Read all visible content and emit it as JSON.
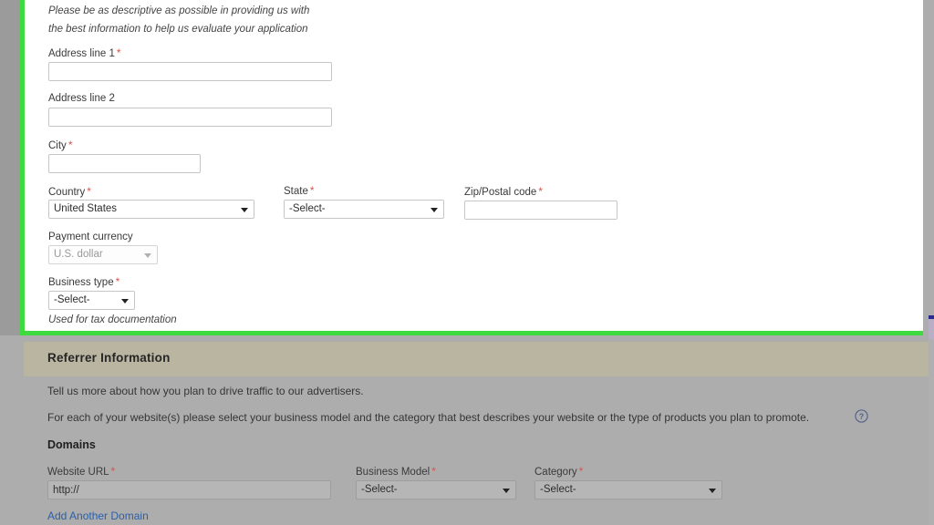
{
  "colors": {
    "highlight_border": "#3ddb3d",
    "section_header_bg": "#b9b5a0",
    "page_bg": "#adadad",
    "required_marker": "#d9534f",
    "link": "#2b5fa8"
  },
  "form": {
    "description_hint_line1": "Please be as descriptive as possible in providing us with",
    "description_hint_line2": "the best information to help us evaluate your application",
    "fields": {
      "address_line_1": {
        "label": "Address line 1",
        "required_marker": "*",
        "value": "",
        "placeholder": ""
      },
      "address_line_2": {
        "label": "Address line 2",
        "required_marker": "",
        "value": "",
        "placeholder": ""
      },
      "city": {
        "label": "City",
        "required_marker": "*",
        "value": "",
        "placeholder": ""
      },
      "country": {
        "label": "Country",
        "required_marker": "*",
        "value": "United States"
      },
      "state": {
        "label": "State",
        "required_marker": "*",
        "value": "-Select-"
      },
      "zip_postal": {
        "label": "Zip/Postal code",
        "required_marker": "*",
        "value": "",
        "placeholder": ""
      },
      "payment_currency": {
        "label": "Payment currency",
        "required_marker": "",
        "value": "U.S. dollar",
        "disabled": true
      },
      "business_type": {
        "label": "Business type",
        "required_marker": "*",
        "value": "-Select-"
      }
    },
    "business_type_hint": "Used for tax documentation"
  },
  "referrer": {
    "header_title": "Referrer Information",
    "paragraph_1": "Tell us more about how you plan to drive traffic to our advertisers.",
    "paragraph_2": "For each of your website(s) please select your business model and the category that best describes your website or the type of products you plan to promote.",
    "help_icon_glyph": "?",
    "domains_title": "Domains",
    "domain_fields": {
      "website_url": {
        "label": "Website URL",
        "required_marker": "*",
        "value": "http://"
      },
      "business_model": {
        "label": "Business Model",
        "required_marker": "*",
        "value": "-Select-"
      },
      "category": {
        "label": "Category",
        "required_marker": "*",
        "value": "-Select-"
      }
    },
    "add_domain_link": "Add Another Domain"
  }
}
